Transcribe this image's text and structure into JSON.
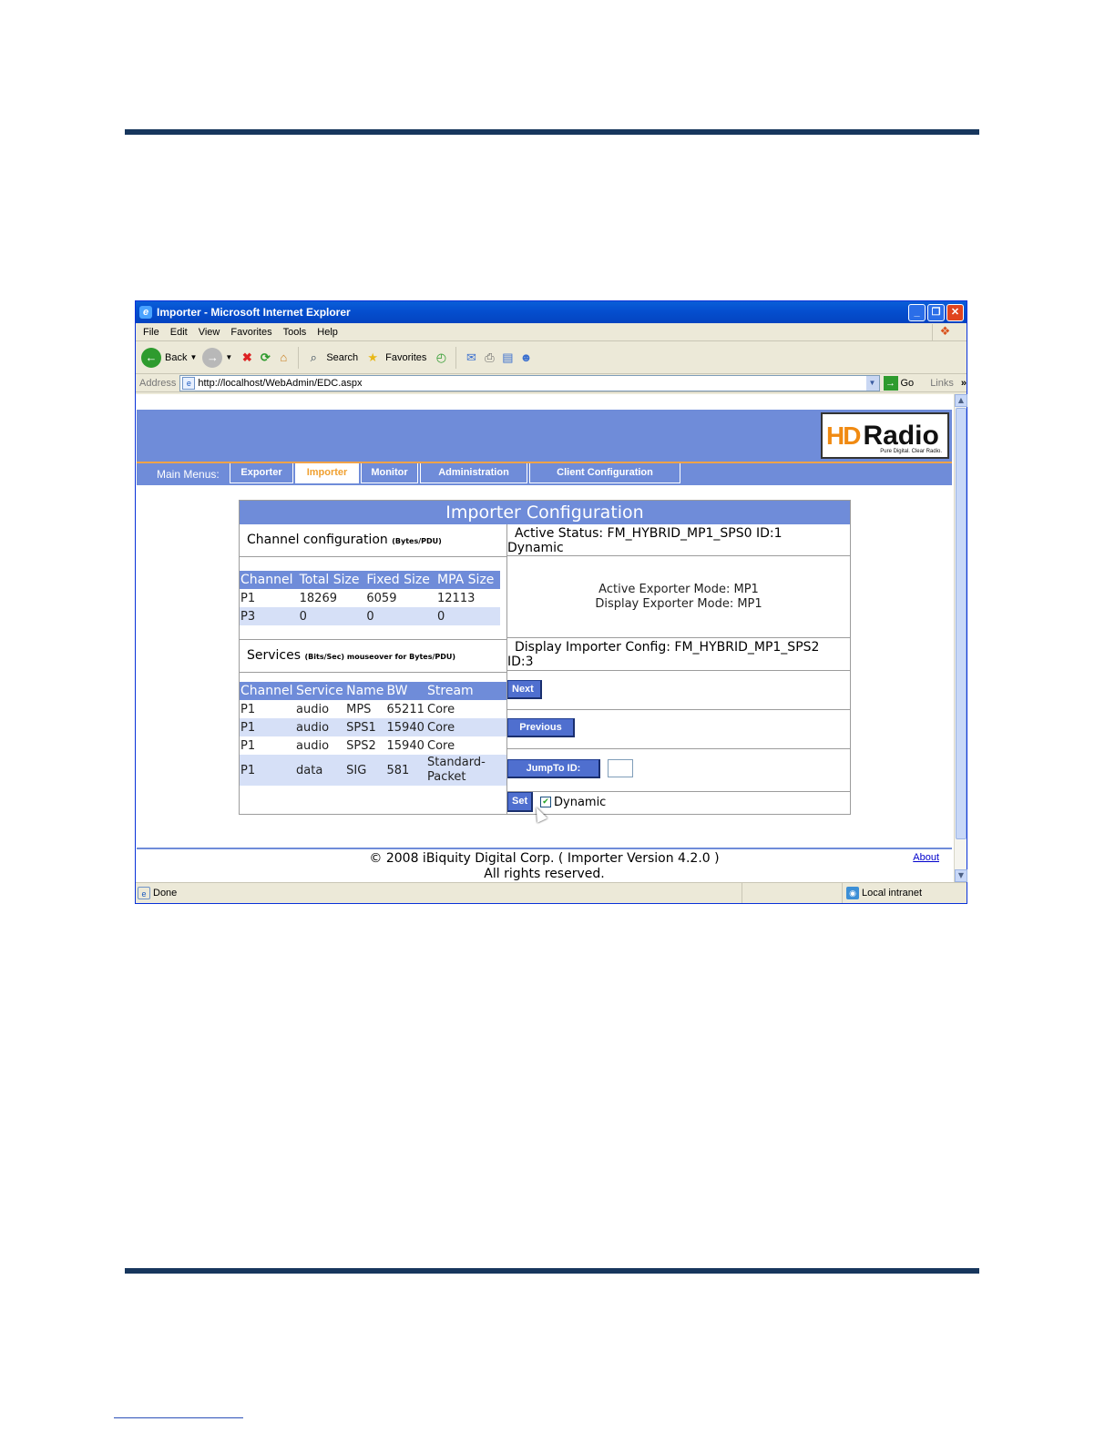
{
  "window": {
    "title": "Importer - Microsoft Internet Explorer",
    "menu": [
      "File",
      "Edit",
      "View",
      "Favorites",
      "Tools",
      "Help"
    ],
    "toolbar": {
      "back": "Back",
      "search": "Search",
      "favorites": "Favorites"
    },
    "address": {
      "label": "Address",
      "url": "http://localhost/WebAdmin/EDC.aspx",
      "go": "Go",
      "links": "Links"
    },
    "status": {
      "text": "Done",
      "zone": "Local intranet"
    }
  },
  "site": {
    "logo": {
      "hd": "HD",
      "radio": "Radio",
      "tagline": "Pure Digital. Clear Radio."
    },
    "nav": {
      "label": "Main Menus:",
      "items": [
        "Exporter",
        "Importer",
        "Monitor",
        "Administration",
        "Client Configuration"
      ],
      "active": "Importer"
    },
    "footer": {
      "copyright": "© 2008 iBiquity Digital Corp. ( Importer Version 4.2.0 )",
      "rights": "All rights reserved.",
      "about": "About"
    }
  },
  "config": {
    "title": "Importer Configuration",
    "channel": {
      "heading": "Channel configuration",
      "unit": "(Bytes/PDU)",
      "columns": [
        "Channel",
        "Total Size",
        "Fixed Size",
        "MPA Size"
      ],
      "rows": [
        [
          "P1",
          "18269",
          "6059",
          "12113"
        ],
        [
          "P3",
          "0",
          "0",
          "0"
        ]
      ]
    },
    "services": {
      "heading": "Services",
      "unit": "(Bits/Sec) mouseover for Bytes/PDU)",
      "columns": [
        "Channel",
        "Service",
        "Name",
        "BW",
        "Stream"
      ],
      "rows": [
        [
          "P1",
          "audio",
          "MPS",
          "65211",
          "Core"
        ],
        [
          "P1",
          "audio",
          "SPS1",
          "15940",
          "Core"
        ],
        [
          "P1",
          "audio",
          "SPS2",
          "15940",
          "Core"
        ],
        [
          "P1",
          "data",
          "SIG",
          "581",
          "Standard-Packet"
        ]
      ]
    },
    "active_status": {
      "line1": "Active Status: FM_HYBRID_MP1_SPS0 ID:1",
      "line2": "Dynamic"
    },
    "modes": {
      "active": "Active Exporter Mode: MP1",
      "display": "Display Exporter Mode: MP1"
    },
    "display_config": {
      "line1": "Display Importer Config: FM_HYBRID_MP1_SPS2",
      "line2": "ID:3"
    },
    "buttons": {
      "next": "Next",
      "previous": "Previous",
      "jump": "JumpTo ID:",
      "set": "Set"
    },
    "jump_value": "",
    "dynamic_label": "Dynamic",
    "dynamic_checked": true
  },
  "colors": {
    "accent": "#6f8cd9",
    "nav_border": "#f1a348",
    "rule": "#17365d"
  }
}
